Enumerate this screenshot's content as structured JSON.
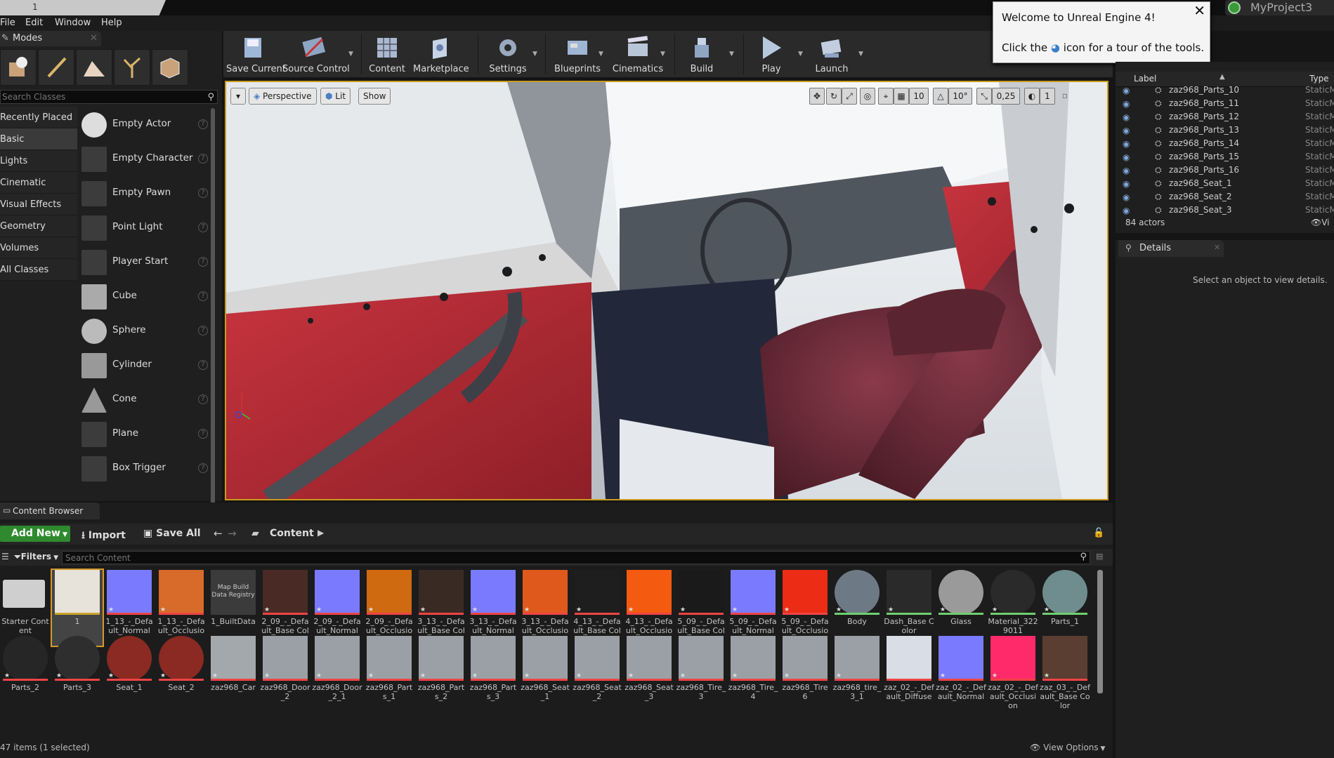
{
  "title_tab": "1",
  "project_name": "MyProject3",
  "menu": [
    "File",
    "Edit",
    "Window",
    "Help"
  ],
  "modes": {
    "title": "Modes",
    "search_placeholder": "Search Classes",
    "categories": [
      "Recently Placed",
      "Basic",
      "Lights",
      "Cinematic",
      "Visual Effects",
      "Geometry",
      "Volumes",
      "All Classes"
    ],
    "items": [
      "Empty Actor",
      "Empty Character",
      "Empty Pawn",
      "Point Light",
      "Player Start",
      "Cube",
      "Sphere",
      "Cylinder",
      "Cone",
      "Plane",
      "Box Trigger"
    ]
  },
  "toolbar": {
    "buttons": [
      "Save Current",
      "Source Control",
      "Content",
      "Marketplace",
      "Settings",
      "Blueprints",
      "Cinematics",
      "Build",
      "Play",
      "Launch"
    ]
  },
  "viewport": {
    "perspective": "Perspective",
    "lit": "Lit",
    "show": "Show",
    "grid_snap": "10",
    "rot_snap": "10°",
    "scale_snap": "0,25",
    "cam_speed": "1"
  },
  "welcome": {
    "title": "Welcome to Unreal Engine 4!",
    "body_pre": "Click the",
    "body_post": "icon for a tour of the tools."
  },
  "outliner": {
    "col_label": "Label",
    "col_type": "Type",
    "rows": [
      "zaz968_Parts_10",
      "zaz968_Parts_11",
      "zaz968_Parts_12",
      "zaz968_Parts_13",
      "zaz968_Parts_14",
      "zaz968_Parts_15",
      "zaz968_Parts_16",
      "zaz968_Seat_1",
      "zaz968_Seat_2",
      "zaz968_Seat_3"
    ],
    "row_type": "StaticM",
    "actor_count": "84 actors",
    "view_label": "Vi"
  },
  "details": {
    "title": "Details",
    "empty": "Select an object to view details."
  },
  "content_browser": {
    "title": "Content Browser",
    "add_new": "Add New",
    "import": "Import",
    "save_all": "Save All",
    "path": "Content",
    "filters": "Filters",
    "search_placeholder": "Search Content",
    "status": "47 items (1 selected)",
    "view_options": "View Options",
    "row1": [
      "Starter Content",
      "1",
      "1_13_-_Default_Normal",
      "1_13_-_Default_Occlusion",
      "1_BuiltData",
      "2_09_-_Default_Base Color",
      "2_09_-_Default_Normal",
      "2_09_-_Default_Occlusion",
      "3_13_-_Default_Base Color",
      "3_13_-_Default_Normal",
      "3_13_-_Default_Occlusion",
      "4_13_-_Default_Base Color",
      "4_13_-_Default_Occlusion",
      "5_09_-_Default_Base Color",
      "5_09_-_Default_Normal",
      "5_09_-_Default_Occlusion",
      "Body",
      "Dash_Base Color",
      "Glass",
      "Material_3229011",
      "Parts_1"
    ],
    "row2": [
      "Parts_2",
      "Parts_3",
      "Seat_1",
      "Seat_2",
      "zaz968_Car",
      "zaz968_Door_2",
      "zaz968_Door_2_1",
      "zaz968_Parts_1",
      "zaz968_Parts_2",
      "zaz968_Parts_3",
      "zaz968_Seat_1",
      "zaz968_Seat_2",
      "zaz968_Seat_3",
      "zaz968_Tire_3",
      "zaz968_Tire_4",
      "zaz968_Tire6",
      "zaz968_tire_3_1",
      "zaz_02_-_Default_Diffuse",
      "zaz_02_-_Default_Normal",
      "zaz_02_-_Default_Occlusion",
      "zaz_03_-_Default_Base Color"
    ],
    "map_build_thumb": "Map Build Data Registry"
  }
}
